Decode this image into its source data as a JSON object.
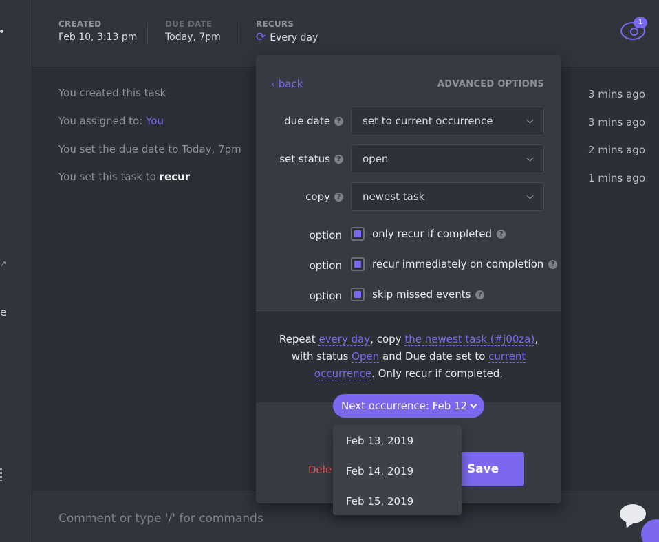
{
  "header": {
    "created_label": "CREATED",
    "created_value": "Feb 10, 3:13 pm",
    "due_label": "DUE DATE",
    "due_value": "Today, 7pm",
    "recurs_label": "RECURS",
    "recurs_value": "Every day",
    "watchers_count": "1"
  },
  "rail": {
    "letter": "e"
  },
  "activity": [
    {
      "text": "You created this task",
      "time": "3 mins ago"
    },
    {
      "prefix": "You assigned to: ",
      "highlight": "You",
      "time": "3 mins ago"
    },
    {
      "text": "You set the due date to Today, 7pm",
      "time": "2 mins ago"
    },
    {
      "prefix": "You set this task to ",
      "bold": "recur",
      "time": "1 mins ago"
    }
  ],
  "panel": {
    "back_label": "back",
    "title": "ADVANCED OPTIONS",
    "rows": [
      {
        "label": "due date",
        "value": "set to current occurrence"
      },
      {
        "label": "set status",
        "value": "open"
      },
      {
        "label": "copy",
        "value": "newest task"
      }
    ],
    "options": [
      {
        "label": "option",
        "text": "only recur if completed",
        "checked": true
      },
      {
        "label": "option",
        "text": "recur immediately on completion",
        "checked": true
      },
      {
        "label": "option",
        "text": "skip missed events",
        "checked": true
      }
    ],
    "summary": {
      "t1": "Repeat ",
      "l1": "every day",
      "t2": ", copy ",
      "l2": "the newest task (#j00za)",
      "t3": ", with status ",
      "l3": "Open",
      "t4": " and Due date set to ",
      "l4": "current occurrence",
      "t5": ". Only recur if completed."
    },
    "next_label": "Next occurrence: Feb 12",
    "delete_label": "Dele",
    "save_label": "Save"
  },
  "next_dropdown": [
    "Feb 13, 2019",
    "Feb 14, 2019",
    "Feb 15, 2019"
  ],
  "comment": {
    "placeholder": "Comment or type '/' for commands"
  },
  "colors": {
    "accent": "#7b68ee",
    "danger": "#e5575a"
  }
}
